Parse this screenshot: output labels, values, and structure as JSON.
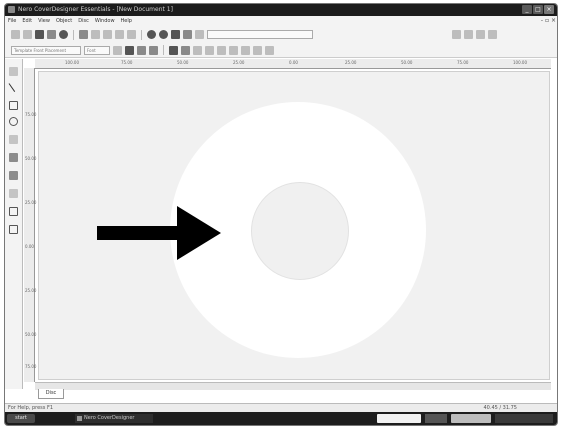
{
  "window": {
    "title": "Nero CoverDesigner Essentials - [New Document 1]",
    "controls": [
      "_",
      "□",
      "×"
    ]
  },
  "menu": {
    "items": [
      "File",
      "Edit",
      "View",
      "Object",
      "Disc",
      "Window",
      "Help"
    ],
    "right_control": "- ▫ ×"
  },
  "toolbar2": {
    "template_label": "Template Front Placement",
    "dropdown_value": "Font"
  },
  "rulers": {
    "horizontal": [
      "100.00",
      "75.00",
      "50.00",
      "25.00",
      "0.00",
      "25.00",
      "50.00",
      "75.00",
      "100.00"
    ],
    "vertical": [
      "75.00",
      "50.00",
      "25.00",
      "0.00",
      "25.00",
      "50.00",
      "75.00"
    ]
  },
  "canvas": {
    "disc_color": "#ffffff",
    "hub_color": "#f0f0f0",
    "background_color": "#f1f1f1",
    "arrow_color": "#000000"
  },
  "page_tab": {
    "label": "Disc"
  },
  "status": {
    "left": "For Help, press F1",
    "right": "40.45 / 31.75"
  },
  "taskbar": {
    "start_label": "start",
    "task_label": "Nero CoverDesigner"
  }
}
